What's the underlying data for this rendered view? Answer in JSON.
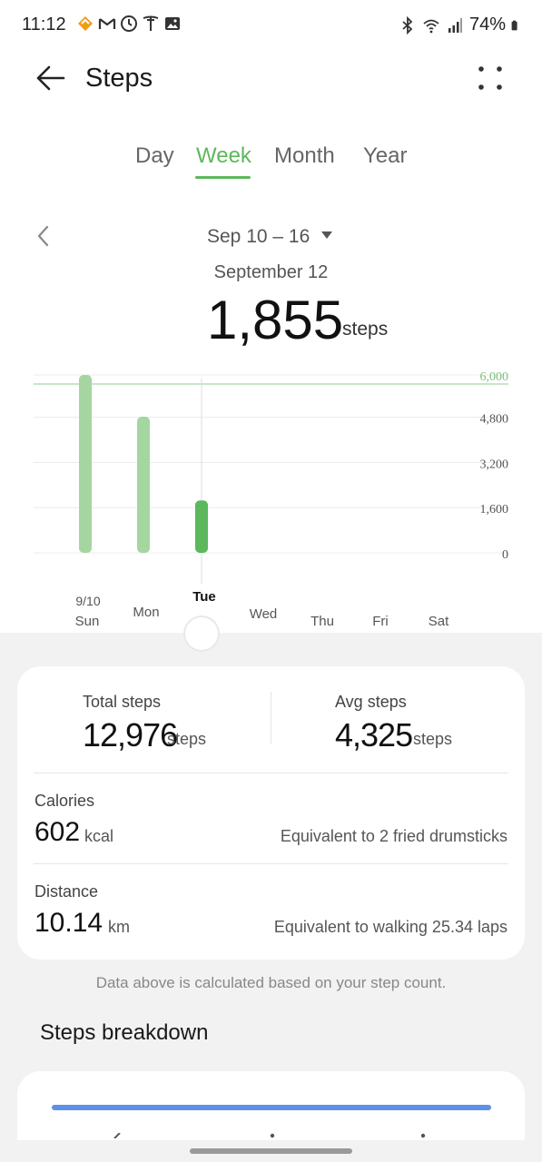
{
  "status_bar": {
    "time": "11:12",
    "battery": "74%",
    "left_icons": [
      "orange-badge-icon",
      "gmail-icon",
      "clock-icon",
      "tesla-icon",
      "gallery-icon"
    ],
    "right_icons": [
      "bluetooth-icon",
      "wifi-icon",
      "signal-icon",
      "battery-icon"
    ]
  },
  "header": {
    "title": "Steps"
  },
  "tabs": [
    {
      "label": "Day",
      "active": false
    },
    {
      "label": "Week",
      "active": true
    },
    {
      "label": "Month",
      "active": false
    },
    {
      "label": "Year",
      "active": false
    }
  ],
  "week": {
    "range": "Sep 10 – 16",
    "selected_date": "September 12",
    "selected_steps": "1,855",
    "steps_unit": "steps"
  },
  "chart_data": {
    "type": "bar",
    "categories": [
      "Sun",
      "Mon",
      "Tue",
      "Wed",
      "Thu",
      "Fri",
      "Sat"
    ],
    "first_date_label": "9/10",
    "values": [
      6300,
      4820,
      1855,
      0,
      0,
      0,
      0
    ],
    "selected_index": 2,
    "goal": 6000,
    "ylim": [
      0,
      6300
    ],
    "yticks": [
      "0",
      "1,600",
      "3,200",
      "4,800",
      "6,000"
    ],
    "ytick_values": [
      0,
      1600,
      3200,
      4800,
      6000
    ],
    "colors": {
      "bar": "#a5d6a1",
      "selected": "#5cb85c",
      "goal_line": "#a6d8a3",
      "goal_label": "#7fbf7b"
    }
  },
  "summary": {
    "total_label": "Total steps",
    "total_value": "12,976",
    "total_unit": "steps",
    "avg_label": "Avg steps",
    "avg_value": "4,325",
    "avg_unit": "steps",
    "calories_label": "Calories",
    "calories_value": "602",
    "calories_unit": "kcal",
    "calories_eq": "Equivalent to 2 fried drumsticks",
    "distance_label": "Distance",
    "distance_value": "10.14",
    "distance_unit": "km",
    "distance_eq": "Equivalent to walking 25.34 laps"
  },
  "note": "Data above is calculated based on your step count.",
  "breakdown": {
    "title": "Steps breakdown",
    "progress": 1.0,
    "color": "#5b91e8"
  }
}
